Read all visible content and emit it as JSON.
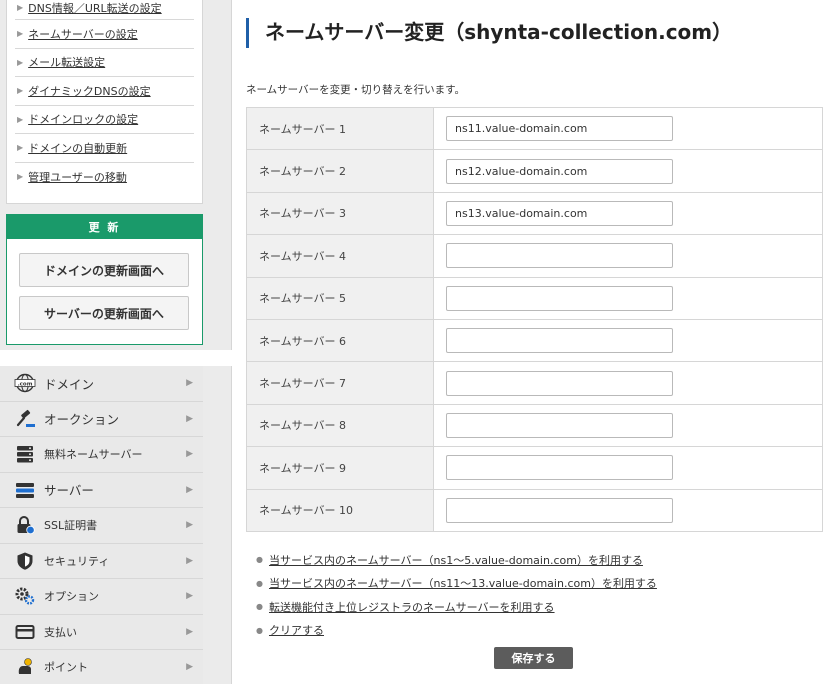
{
  "submenu": {
    "items": [
      {
        "label": "DNS情報／URL転送の設定"
      },
      {
        "label": "ネームサーバーの設定"
      },
      {
        "label": "メール転送設定"
      },
      {
        "label": "ダイナミックDNSの設定"
      },
      {
        "label": "ドメインロックの設定"
      },
      {
        "label": "ドメインの自動更新"
      },
      {
        "label": "管理ユーザーの移動"
      }
    ]
  },
  "renew": {
    "title": "更 新",
    "domain_button": "ドメインの更新画面へ",
    "server_button": "サーバーの更新画面へ",
    "accent_color": "#1a9a6a"
  },
  "nav": {
    "items": [
      {
        "label": "ドメイン",
        "icon": "domain-globe-icon"
      },
      {
        "label": "オークション",
        "icon": "auction-gavel-icon"
      },
      {
        "label": "無料ネームサーバー",
        "icon": "free-nameserver-icon"
      },
      {
        "label": "サーバー",
        "icon": "server-icon"
      },
      {
        "label": "SSL証明書",
        "icon": "ssl-lock-icon"
      },
      {
        "label": "セキュリティ",
        "icon": "shield-icon"
      },
      {
        "label": "オプション",
        "icon": "gears-icon"
      },
      {
        "label": "支払い",
        "icon": "card-icon"
      },
      {
        "label": "ポイント",
        "icon": "points-icon"
      }
    ]
  },
  "page": {
    "title": "ネームサーバー変更（shynta-collection.com）",
    "description": "ネームサーバーを変更・切り替えを行います。",
    "title_accent_color": "#1f5fa8"
  },
  "nameservers": [
    {
      "label": "ネームサーバー 1",
      "value": "ns11.value-domain.com"
    },
    {
      "label": "ネームサーバー 2",
      "value": "ns12.value-domain.com"
    },
    {
      "label": "ネームサーバー 3",
      "value": "ns13.value-domain.com"
    },
    {
      "label": "ネームサーバー 4",
      "value": ""
    },
    {
      "label": "ネームサーバー 5",
      "value": ""
    },
    {
      "label": "ネームサーバー 6",
      "value": ""
    },
    {
      "label": "ネームサーバー 7",
      "value": ""
    },
    {
      "label": "ネームサーバー 8",
      "value": ""
    },
    {
      "label": "ネームサーバー 9",
      "value": ""
    },
    {
      "label": "ネームサーバー 10",
      "value": ""
    }
  ],
  "links": [
    {
      "label": "当サービス内のネームサーバー（ns1〜5.value-domain.com）を利用する"
    },
    {
      "label": "当サービス内のネームサーバー（ns11〜13.value-domain.com）を利用する"
    },
    {
      "label": "転送機能付き上位レジストラのネームサーバーを利用する"
    },
    {
      "label": "クリアする"
    }
  ],
  "save_button": "保存する"
}
